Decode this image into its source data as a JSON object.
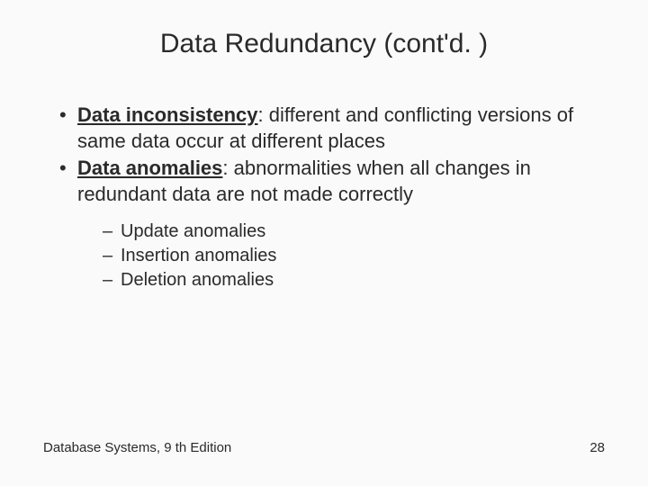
{
  "title": "Data Redundancy (cont'd. )",
  "bullets": [
    {
      "term": "Data inconsistency",
      "rest": ": different and conflicting versions of same data occur at different places"
    },
    {
      "term": "Data anomalies",
      "rest": ": abnormalities when all changes in redundant data are not made correctly"
    }
  ],
  "subbullets": [
    "Update anomalies",
    "Insertion anomalies",
    "Deletion anomalies"
  ],
  "footer": {
    "left": "Database Systems, 9 th Edition",
    "right": "28"
  }
}
